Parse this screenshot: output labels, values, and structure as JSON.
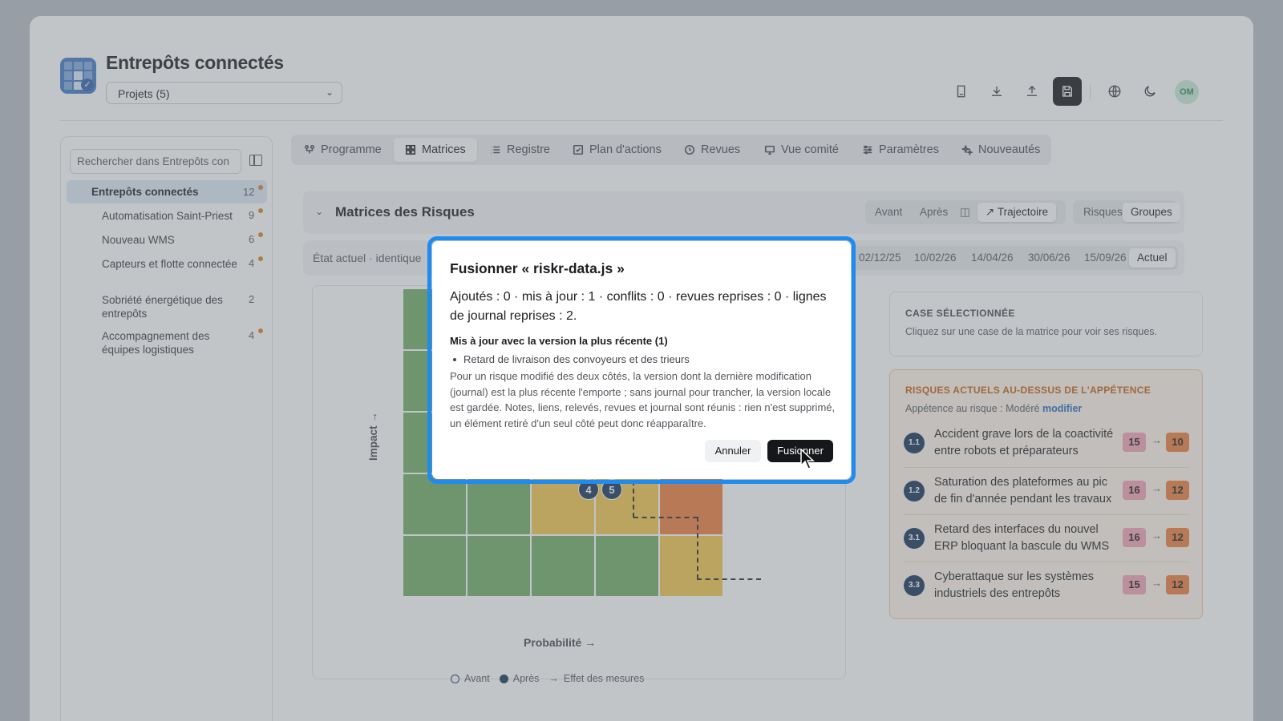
{
  "header": {
    "app_title": "Entrepôts connectés",
    "project_select": "Projets (5)",
    "toolbar_icons": [
      "book-icon",
      "download-icon",
      "upload-icon",
      "save-icon",
      "globe-icon",
      "moon-icon"
    ],
    "avatar_initials": "OM"
  },
  "sidebar": {
    "search_placeholder": "Rechercher dans Entrepôts con",
    "root": {
      "label": "Entrepôts connectés",
      "count": "12",
      "flag": true
    },
    "items": [
      {
        "label": "Automatisation Saint-Priest",
        "count": "9",
        "flag": true
      },
      {
        "label": "Nouveau WMS",
        "count": "6",
        "flag": true
      },
      {
        "label": "Capteurs et flotte connectée",
        "count": "4",
        "flag": true
      },
      {
        "label": "Sobriété énergétique des entrepôts",
        "count": "2",
        "flag": false
      },
      {
        "label": "Accompagnement des équipes logistiques",
        "count": "4",
        "flag": true
      }
    ]
  },
  "tabs": [
    {
      "label": "Programme",
      "icon": "program-icon"
    },
    {
      "label": "Matrices",
      "icon": "grid-icon",
      "active": true
    },
    {
      "label": "Registre",
      "icon": "list-icon"
    },
    {
      "label": "Plan d'actions",
      "icon": "checkbox-icon"
    },
    {
      "label": "Revues",
      "icon": "clock-icon"
    },
    {
      "label": "Vue comité",
      "icon": "monitor-icon"
    },
    {
      "label": "Paramètres",
      "icon": "sliders-icon"
    },
    {
      "label": "Nouveautés",
      "icon": "sparkle-icon"
    }
  ],
  "panel": {
    "title": "Matrices des Risques",
    "view_toggle": {
      "before": "Avant",
      "after": "Après",
      "trajectory": "Trajectoire"
    },
    "mode_toggle": {
      "risks": "Risques",
      "groups": "Groupes",
      "active": "Groupes"
    },
    "state_text": "État actuel · identique",
    "dates": [
      "02/12/25",
      "10/02/26",
      "14/04/26",
      "30/06/26",
      "15/09/26",
      "Actuel"
    ],
    "active_date": "Actuel"
  },
  "matrix": {
    "y_label": "Impact →",
    "x_label": "Probabilité →",
    "bubbles": [
      "4",
      "5"
    ],
    "legend": {
      "before": "Avant",
      "after": "Après",
      "effect": "Effet des mesures"
    },
    "colors": {
      "green": "#6fad62",
      "yellow": "#f1c64c",
      "orange": "#ee7c3b",
      "pink": "#f5a3b3"
    }
  },
  "selected_cell": {
    "title": "CASE SÉLECTIONNÉE",
    "hint": "Cliquez sur une case de la matrice pour voir ses risques."
  },
  "above_appetite": {
    "title": "RISQUES ACTUELS AU-DESSUS DE L'APPÉTENCE",
    "appetite_label": "Appétence au risque : Modéré",
    "modify_link": "modifier",
    "risks": [
      {
        "id": "1.1",
        "label": "Accident grave lors de la coactivité entre robots et préparateurs",
        "before": "15",
        "after": "10"
      },
      {
        "id": "1.2",
        "label": "Saturation des plateformes au pic de fin d'année pendant les travaux",
        "before": "16",
        "after": "12"
      },
      {
        "id": "3.1",
        "label": "Retard des interfaces du nouvel ERP bloquant la bascule du WMS",
        "before": "16",
        "after": "12"
      },
      {
        "id": "3.3",
        "label": "Cyberattaque sur les systèmes industriels des entrepôts",
        "before": "15",
        "after": "12"
      }
    ]
  },
  "dialog": {
    "title": "Fusionner « riskr-data.js »",
    "summary": "Ajoutés : 0 · mis à jour : 1 · conflits : 0 · revues reprises : 0 · lignes de journal reprises : 2.",
    "updated_heading": "Mis à jour avec la version la plus récente (1)",
    "updated_items": [
      "Retard de livraison des convoyeurs et des trieurs"
    ],
    "note": "Pour un risque modifié des deux côtés, la version dont la dernière modification (journal) est la plus récente l'emporte ; sans journal pour trancher, la version locale est gardée. Notes, liens, relevés, revues et journal sont réunis : rien n'est supprimé, un élément retiré d'un seul côté peut donc réapparaître.",
    "cancel_label": "Annuler",
    "merge_label": "Fusionner"
  }
}
